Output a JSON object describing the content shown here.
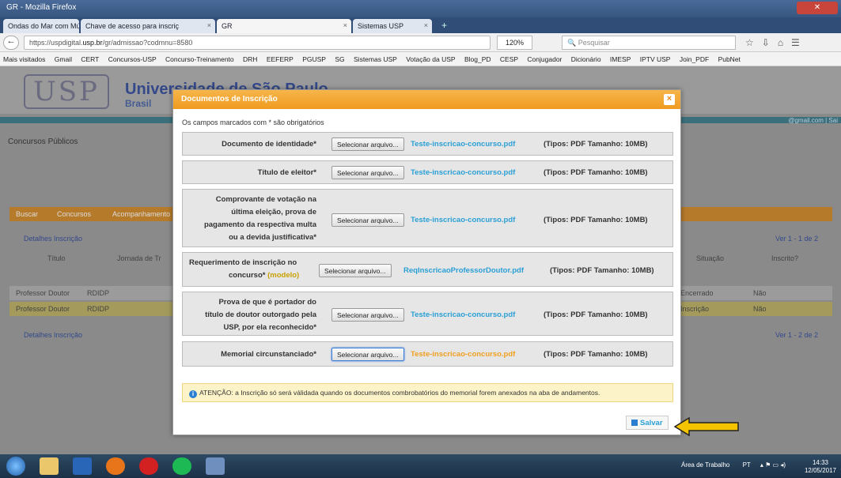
{
  "window": {
    "title": "GR - Mozilla Firefox"
  },
  "tabs": [
    {
      "label": "Ondas do Mar com Músi"
    },
    {
      "label": "Chave de acesso para inscriç"
    },
    {
      "label": "GR"
    },
    {
      "label": "Sistemas USP"
    }
  ],
  "nav": {
    "url_prefix": "https://uspdigital.",
    "url_domain": "usp.br",
    "url_rest": "/gr/admissao?codmnu=8580",
    "zoom": "120%",
    "search_placeholder": "Pesquisar"
  },
  "bookmarks": [
    "Mais visitados",
    "Gmail",
    "CERT",
    "Concursos-USP",
    "Concurso-Treinamento",
    "DRH",
    "EEFERP",
    "PGUSP",
    "SG",
    "Sistemas USP",
    "Votação da USP",
    "Blog_PD",
    "CESP",
    "Conjugador",
    "Dicionário",
    "IMESP",
    "IPTV USP",
    "Join_PDF",
    "PubNet"
  ],
  "page": {
    "univ_name": "Universidade de São Paulo",
    "country": "Brasil",
    "logo_text": "USP",
    "email_fragment": "@gmail.com | Sai",
    "section": "Concursos Públicos",
    "bg_tabs": [
      "Buscar",
      "Concursos",
      "Acompanhamento"
    ],
    "bg_actions": "Detalhes  Inscrição",
    "bg_pager": "Ver 1 - 1 de 2",
    "bg_pager2": "Ver 1 - 2 de 2",
    "bg_headers": [
      "Título",
      "Jornada de Tr",
      "Situação",
      "Inscrito?"
    ],
    "bg_rows": [
      {
        "titulo": "Professor Doutor",
        "jornada": "RDIDP",
        "situacao": "Encerrado",
        "inscrito": "Não"
      },
      {
        "titulo": "Professor Doutor",
        "jornada": "RDIDP",
        "situacao": "Inscrição",
        "inscrito": "Não"
      }
    ]
  },
  "modal": {
    "title": "Documentos de Inscrição",
    "close": "×",
    "required_note": "Os campos marcados com * são obrigatórios",
    "select_label": "Selecionar arquivo...",
    "rows": [
      {
        "label": "Documento de identidade*",
        "file": "Teste-inscricao-concurso.pdf",
        "types": "(Tipos: PDF Tamanho: 10MB)"
      },
      {
        "label": "Título de eleitor*",
        "file": "Teste-inscricao-concurso.pdf",
        "types": "(Tipos: PDF Tamanho: 10MB)"
      },
      {
        "label_lines": [
          "Comprovante de votação na",
          "última eleição, prova de",
          "pagamento da respectiva multa",
          "ou a devida justificativa*"
        ],
        "file": "Teste-inscricao-concurso.pdf",
        "types": "(Tipos: PDF Tamanho: 10MB)"
      },
      {
        "label_lines": [
          "Requerimento de inscrição no",
          "concurso*"
        ],
        "modelo": "(modelo)",
        "file": "ReqInscricaoProfessorDoutor.pdf",
        "types": "(Tipos: PDF Tamanho: 10MB)"
      },
      {
        "label_lines": [
          "Prova de que é portador do",
          "título de doutor outorgado pela",
          "USP, por ela reconhecido*"
        ],
        "file": "Teste-inscricao-concurso.pdf",
        "types": "(Tipos: PDF Tamanho: 10MB)"
      },
      {
        "label": "Memorial circunstanciado*",
        "file": "Teste-inscricao-concurso.pdf",
        "types": "(Tipos: PDF Tamanho: 10MB)"
      }
    ],
    "warning": "ATENÇÃO: a Inscrição só será válidada quando os documentos combrobatórios do memorial forem anexados na aba de andamentos.",
    "save": "Salvar"
  },
  "taskbar": {
    "tray_text": "Área de Trabalho",
    "lang": "PT",
    "time": "14:33",
    "date": "12/05/2017"
  },
  "colors": {
    "accent_orange": "#f09b1f",
    "link_blue": "#2a9fd6",
    "arrow_yellow": "#f5c400"
  }
}
